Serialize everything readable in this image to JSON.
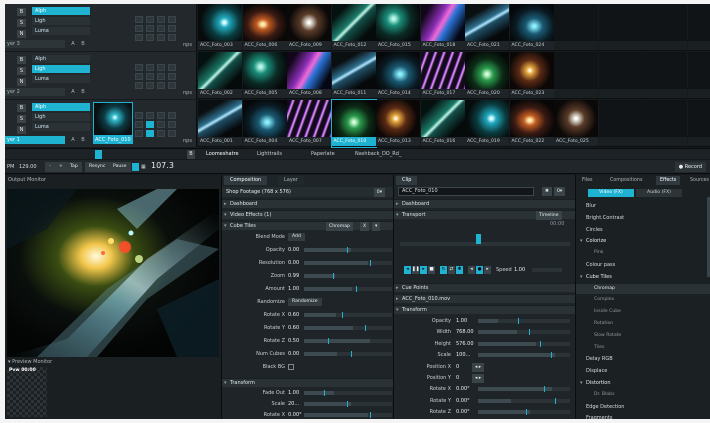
{
  "layers": [
    {
      "blend": [
        "Alph",
        "Ligh",
        "Luma"
      ],
      "buttons": [
        "B",
        "S",
        "N"
      ],
      "name": "yer 3",
      "ab": [
        "A",
        "B"
      ],
      "nps": "nps",
      "clips": [
        "ACC_Foto_003",
        "ACC_Foto_006",
        "ACC_Foto_009",
        "ACC_Foto_012",
        "ACC_Foto_015",
        "ACC_Foto_018",
        "ACC_Foto_021",
        "ACC_Foto_024",
        "",
        "",
        "",
        ""
      ]
    },
    {
      "blend": [
        "Alph",
        "Ligh",
        "Luma"
      ],
      "buttons": [
        "B",
        "S",
        "N"
      ],
      "name": "yer 2",
      "ab": [
        "A",
        "B"
      ],
      "nps": "nps",
      "clips": [
        "ACC_Foto_002",
        "ACC_Foto_005",
        "ACC_Foto_008",
        "ACC_Foto_011",
        "ACC_Foto_014",
        "ACC_Foto_017",
        "ACC_Foto_020",
        "ACC_Foto_023",
        "",
        "",
        "",
        ""
      ]
    },
    {
      "blend": [
        "Alph",
        "Ligh",
        "Luma"
      ],
      "buttons": [
        "B",
        "S",
        "N"
      ],
      "name": "yer 1",
      "ab": [
        "A",
        "B"
      ],
      "nps": "nps",
      "thumb_label": "ACC_Foto_010",
      "clips": [
        "ACC_Foto_001",
        "ACC_Foto_004",
        "ACC_Foto_007",
        "ACC_Foto_010",
        "ACC_Foto_013",
        "ACC_Foto_016",
        "ACC_Foto_019",
        "ACC_Foto_022",
        "ACC_Foto_025",
        "",
        "",
        ""
      ]
    }
  ],
  "sepbar": {
    "b_label": "B",
    "tabs": [
      "Loomeshatre",
      "Lighttrails",
      "Paperlate",
      "Nashback_DO_Rd_"
    ]
  },
  "transport": {
    "bpm": "PM",
    "bpm_value": "129.00",
    "minus": "-",
    "plus": "+",
    "tap": "Tap",
    "resync": "Resync",
    "pause": "Pause",
    "big_value": "107.3",
    "record": "Record"
  },
  "output": {
    "title": "Output Monitor",
    "preview_title": "Preview Monitor",
    "preview_label": "Pvw 00:00"
  },
  "composition": {
    "tabs": [
      "Composition",
      "Layer"
    ],
    "footage_label": "Shop Footage (768 x 576)",
    "footage_btn": "0▾",
    "sections": {
      "dashboard": "Dashboard",
      "video_effects": "Video Effects (1)",
      "cube_tiles": "Cube Tiles",
      "transform": "Transform"
    },
    "cube_buttons": [
      "Chromap",
      "X",
      "▾"
    ],
    "params": [
      {
        "label": "Blend Mode",
        "pill": "Add"
      },
      {
        "label": "Opacity",
        "value": "0.00"
      },
      {
        "label": "Resolution",
        "value": "0.00"
      },
      {
        "label": "Zoom",
        "value": "0.99"
      },
      {
        "label": "Amount",
        "value": "1.00"
      },
      {
        "label": "Randomize",
        "pill": "Randomize"
      },
      {
        "label": "Rotate X",
        "value": "0.60"
      },
      {
        "label": "Rotate Y",
        "value": "0.60"
      },
      {
        "label": "Rotate Z",
        "value": "0.50"
      },
      {
        "label": "Num Cubes",
        "value": "0.00"
      },
      {
        "label": "Black BG"
      }
    ],
    "transform_params": [
      {
        "label": "Fade Out",
        "value": "1.00"
      },
      {
        "label": "Scale",
        "value": "20..."
      },
      {
        "label": "Rotate X",
        "value": "0.00°"
      }
    ]
  },
  "clip": {
    "title": "Clip",
    "name_value": "ACC_Foto_010",
    "buttons": [
      "✖",
      "0▾"
    ],
    "sections": {
      "dashboard": "Dashboard",
      "transport": "Transport",
      "cue_points": "Cue Points",
      "file": "ACC_Foto_010.mov",
      "transform": "Transform"
    },
    "timeline_btn": "Timeline",
    "timecode": "00:00",
    "speed_label": "Speed",
    "speed_value": "1.00",
    "params": [
      {
        "label": "Opacity",
        "value": "1.00"
      },
      {
        "label": "Width",
        "value": "768.00"
      },
      {
        "label": "Height",
        "value": "576.00"
      },
      {
        "label": "Scale",
        "value": "100..."
      },
      {
        "label": "Position X",
        "value": "0"
      },
      {
        "label": "Position Y",
        "value": "0"
      },
      {
        "label": "Rotate X",
        "value": "0.00°"
      },
      {
        "label": "Rotate Y",
        "value": "0.00°"
      },
      {
        "label": "Rotate Z",
        "value": "0.00°"
      }
    ]
  },
  "effects": {
    "tabs": [
      "Files",
      "Compositions",
      "Effects",
      "Sources"
    ],
    "toggle": [
      "Video (FX)",
      "Audio (FX)"
    ],
    "items": [
      {
        "label": "Blur",
        "kind": "item"
      },
      {
        "label": "Bright.Contrast",
        "kind": "item"
      },
      {
        "label": "Circles",
        "kind": "item"
      },
      {
        "label": "Colorize",
        "kind": "cat"
      },
      {
        "label": "Pink",
        "kind": "sub"
      },
      {
        "label": "Colour pass",
        "kind": "item"
      },
      {
        "label": "Cube Tiles",
        "kind": "cat"
      },
      {
        "label": "Chromap",
        "kind": "sub-sel"
      },
      {
        "label": "Complex",
        "kind": "sub"
      },
      {
        "label": "Inside Cube",
        "kind": "sub"
      },
      {
        "label": "Rotation",
        "kind": "sub"
      },
      {
        "label": "Slow Rotate",
        "kind": "sub"
      },
      {
        "label": "Tiles",
        "kind": "sub"
      },
      {
        "label": "Delay RGB",
        "kind": "item"
      },
      {
        "label": "Displace",
        "kind": "item"
      },
      {
        "label": "Distortion",
        "kind": "cat"
      },
      {
        "label": "Dr. Blobs",
        "kind": "sub"
      },
      {
        "label": "Edge Detection",
        "kind": "item"
      },
      {
        "label": "Fragments",
        "kind": "item"
      }
    ]
  },
  "colors": {
    "accent": "#1fb3d2",
    "panel": "#1e2428",
    "background": "#161a1d"
  }
}
